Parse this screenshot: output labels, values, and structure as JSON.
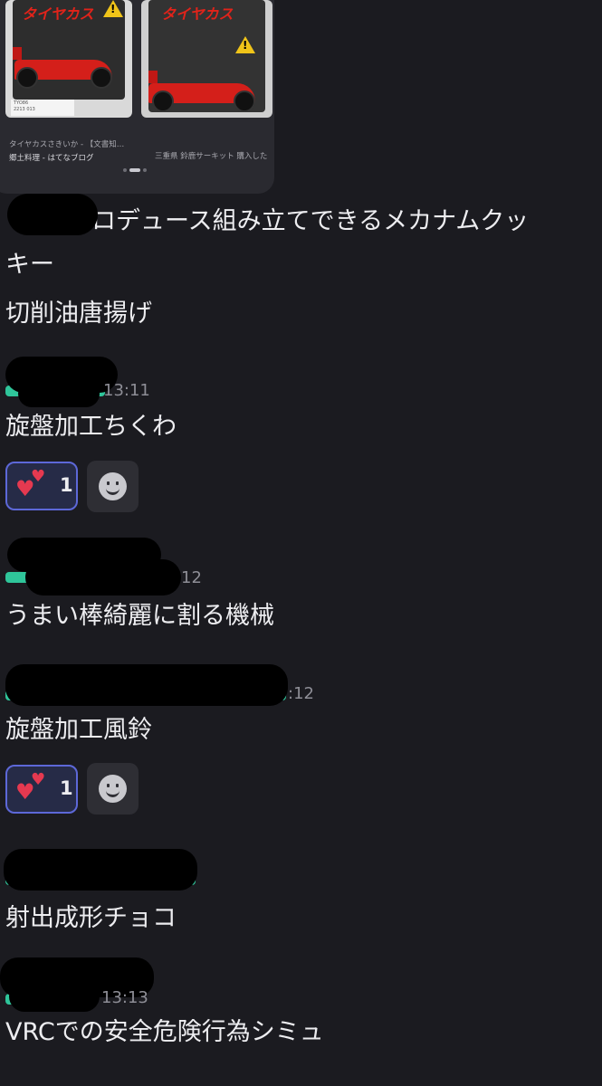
{
  "preview": {
    "items": [
      {
        "package_text": "タイヤカス",
        "caption_title": "タイヤカスさきいか - 【文書知…",
        "caption_source": "郷土料理 - はてなブログ"
      },
      {
        "package_text": "タイヤカス",
        "caption_title": "三重県 鈴鹿サーキット 購入した…",
        "caption_source": ""
      }
    ],
    "pager": {
      "count": 3,
      "active": 1
    }
  },
  "messages": [
    {
      "id": "m1",
      "lines": [
        "プロデュース組み立てできるメカナムクッ",
        "キー",
        "切削油唐揚げ"
      ]
    },
    {
      "id": "m2",
      "time": "13:11",
      "text": "旋盤加工ちくわ",
      "reaction": {
        "emoji": "heart-icon",
        "count": "1"
      }
    },
    {
      "id": "m3",
      "time": "12",
      "text": "うまい棒綺麗に割る機械"
    },
    {
      "id": "m4",
      "time": ":12",
      "text": "旋盤加工風鈴",
      "reaction": {
        "emoji": "heart-icon",
        "count": "1"
      }
    },
    {
      "id": "m5",
      "text": "射出成形チョコ"
    },
    {
      "id": "m6",
      "time": "13:13",
      "text": "VRCでの安全危険行為シミュ"
    }
  ],
  "colors": {
    "background": "#1b1b20",
    "reaction_border": "#5d68d8",
    "reaction_fill": "#262b47",
    "heart": "#e53950",
    "username_green": "#2fc59a"
  }
}
